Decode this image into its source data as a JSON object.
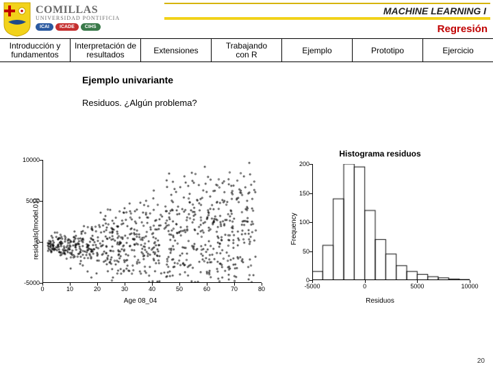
{
  "header": {
    "university_name": "COMILLAS",
    "university_sub": "UNIVERSIDAD PONTIFICIA",
    "pills": [
      "ICAI",
      "ICADE",
      "CIHS"
    ],
    "course_title": "MACHINE LEARNING I",
    "section": "Regresión"
  },
  "tabs": [
    {
      "line1": "Introducción y",
      "line2": "fundamentos"
    },
    {
      "line1": "Interpretación de",
      "line2": "resultados"
    },
    {
      "line1": "Extensiones",
      "line2": ""
    },
    {
      "line1": "Trabajando",
      "line2": "con R"
    },
    {
      "line1": "Ejemplo",
      "line2": ""
    },
    {
      "line1": "Prototipo",
      "line2": ""
    },
    {
      "line1": "Ejercicio",
      "line2": ""
    }
  ],
  "content": {
    "heading": "Ejemplo univariante",
    "body": "Residuos. ¿Algún problema?"
  },
  "chart_data": [
    {
      "type": "scatter",
      "title": "",
      "xlabel": "Age 08_04",
      "ylabel": "residuals(lmodel.01)",
      "xlim": [
        0,
        80
      ],
      "ylim": [
        -5000,
        10000
      ],
      "x_ticks": [
        0,
        10,
        20,
        30,
        40,
        50,
        60,
        70,
        80
      ],
      "y_ticks": [
        -5000,
        0,
        5000,
        10000
      ],
      "n_points": 900,
      "generator": "heteroscedastic_fan",
      "seed": 11
    },
    {
      "type": "bar",
      "title": "Histograma residuos",
      "xlabel": "Residuos",
      "ylabel": "Frequency",
      "xlim": [
        -5000,
        10000
      ],
      "ylim": [
        0,
        200
      ],
      "x_ticks": [
        -5000,
        0,
        5000,
        10000
      ],
      "y_ticks": [
        0,
        50,
        100,
        150,
        200
      ],
      "categories": [
        -4500,
        -3500,
        -2500,
        -1500,
        -500,
        500,
        1500,
        2500,
        3500,
        4500,
        5500,
        6500,
        7500,
        8500,
        9500
      ],
      "values": [
        15,
        60,
        140,
        200,
        195,
        120,
        70,
        45,
        25,
        15,
        10,
        6,
        4,
        2,
        1
      ]
    }
  ],
  "page_number": "20"
}
